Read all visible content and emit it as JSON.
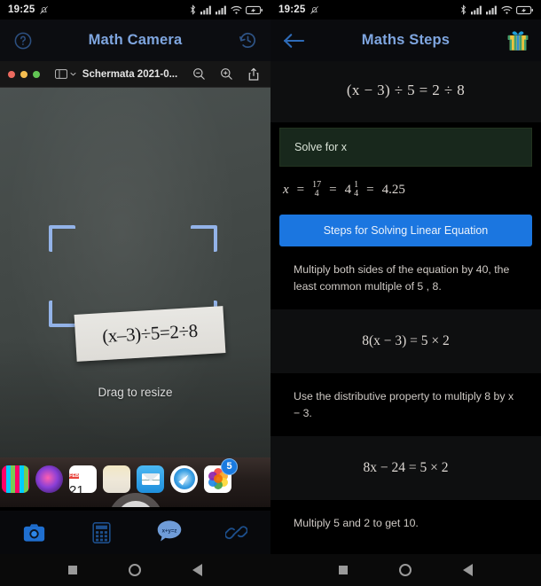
{
  "status_bar": {
    "time": "19:25",
    "icons": [
      "mute-bell-icon",
      "bluetooth-icon",
      "signal-bars-icon",
      "signal-bars-2-icon",
      "wifi-icon",
      "battery-charging-icon"
    ]
  },
  "left_phone": {
    "app_title": "Math Camera",
    "help_icon": "help-circle-icon",
    "history_icon": "history-clock-icon",
    "mac_window": {
      "title": "Schermata 2021-0...",
      "traffic_lights": [
        "close-red",
        "minimize-yellow",
        "zoom-green"
      ],
      "sidebar_icon": "sidebar-toggle-icon",
      "zoom_out_icon": "zoom-out-icon",
      "zoom_in_icon": "zoom-in-icon",
      "share_icon": "share-icon"
    },
    "scanned_equation": "(x–3)÷5=2÷8",
    "drag_hint": "Drag to resize",
    "dock_items": [
      {
        "name": "launchpad",
        "label": ""
      },
      {
        "name": "siri",
        "label": ""
      },
      {
        "name": "calendar",
        "label": "FEB",
        "day": "21"
      },
      {
        "name": "finder",
        "label": ""
      },
      {
        "name": "mail",
        "label": ""
      },
      {
        "name": "safari",
        "label": ""
      },
      {
        "name": "photos",
        "label": "",
        "badge": "5"
      }
    ],
    "shutter_label": "capture-button",
    "bottom_nav": [
      {
        "name": "camera",
        "icon": "camera-icon",
        "active": true
      },
      {
        "name": "calculator",
        "icon": "calculator-icon",
        "active": false
      },
      {
        "name": "chat",
        "icon": "chat-bubble-xyz-icon",
        "label": "x+y=z",
        "active": false
      },
      {
        "name": "link",
        "icon": "link-chain-icon",
        "active": false
      }
    ]
  },
  "right_phone": {
    "app_title": "Maths Steps",
    "back_icon": "back-arrow-icon",
    "gift_icon": "gift-box-icon",
    "equation": {
      "lhs_open": "(",
      "var": "x",
      "minus": "−",
      "three": "3",
      "rhs_close": ")",
      "div": "÷",
      "five": "5",
      "equals": "=",
      "two": "2",
      "eight": "8",
      "display": "(x − 3) ÷ 5 = 2 ÷ 8"
    },
    "solve_for_label": "Solve for x",
    "answer": {
      "var": "x",
      "eq1": "=",
      "frac_num": "17",
      "frac_den": "4",
      "eq2": "=",
      "whole": "4",
      "mixed_num": "1",
      "mixed_den": "4",
      "eq3": "=",
      "decimal": "4.25"
    },
    "steps_button": "Steps for Solving Linear Equation",
    "steps": [
      {
        "text": "Multiply both sides of the equation by 40, the least common multiple of 5 , 8.",
        "equation": "8(x − 3) = 5 × 2"
      },
      {
        "text": "Use the distributive property to multiply 8 by x − 3.",
        "equation": "8x − 24 = 5 × 2"
      },
      {
        "text": "Multiply 5 and 2 to get 10.",
        "equation": ""
      }
    ]
  },
  "android_nav": {
    "recents": "recents-square-icon",
    "home": "home-circle-icon",
    "back": "back-triangle-icon"
  },
  "colors": {
    "accent_blue": "#1b76e0",
    "title_blue": "#7fa6e0",
    "solve_green_bg": "#18281c",
    "bracket_blue": "#93b3e8"
  }
}
